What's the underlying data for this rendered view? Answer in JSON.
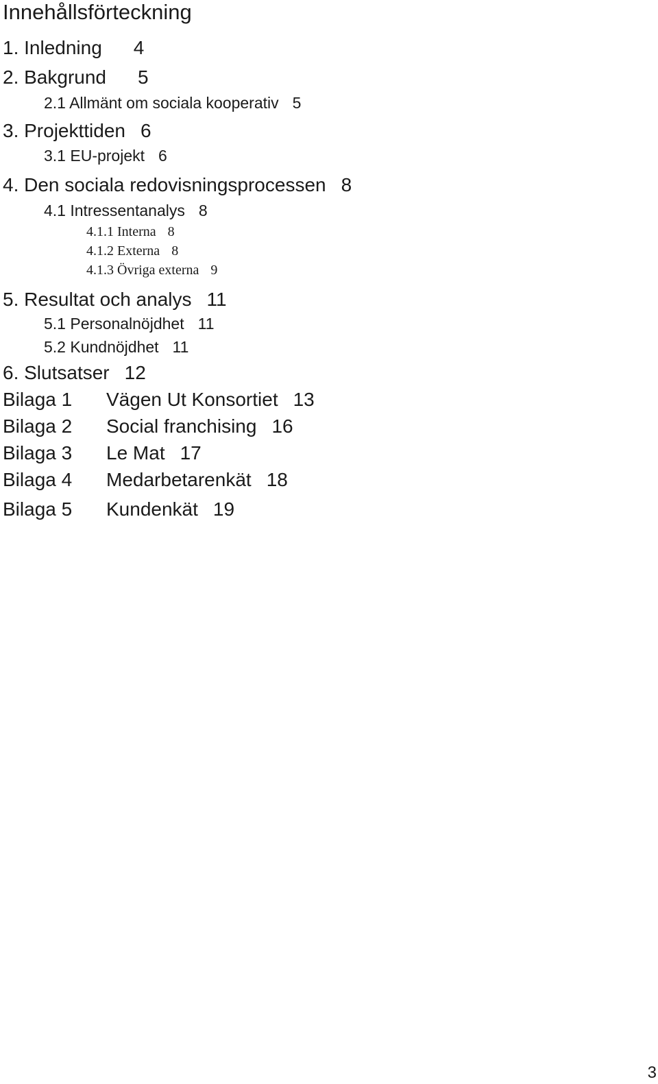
{
  "document": {
    "title": "Innehållsförteckning",
    "page_number": "3",
    "toc": [
      {
        "level": 1,
        "label": "1. Inledning",
        "page": "4"
      },
      {
        "level": 1,
        "label": "2. Bakgrund",
        "page": "5"
      },
      {
        "level": 2,
        "label": "2.1 Allmänt om sociala kooperativ",
        "page": "5"
      },
      {
        "level": 1,
        "label": "3. Projekttiden",
        "page": "6"
      },
      {
        "level": 2,
        "label": "3.1 EU-projekt",
        "page": "6"
      },
      {
        "level": 1,
        "label": "4. Den sociala redovisningsprocessen",
        "page": "8"
      },
      {
        "level": 2,
        "label": "4.1 Intressentanalys",
        "page": "8"
      },
      {
        "level": 3,
        "label": "4.1.1 Interna",
        "page": "8"
      },
      {
        "level": 3,
        "label": "4.1.2 Externa",
        "page": "8"
      },
      {
        "level": 3,
        "label": "4.1.3 Övriga externa",
        "page": "9"
      },
      {
        "level": 1,
        "label": "5. Resultat och analys",
        "page": "11"
      },
      {
        "level": 2,
        "label": "5.1 Personalnöjdhet",
        "page": "11"
      },
      {
        "level": 2,
        "label": "5.2 Kundnöjdhet",
        "page": "11"
      },
      {
        "level": 1,
        "label": "6. Slutsatser",
        "page": "12"
      }
    ],
    "appendices": [
      {
        "label": "Bilaga 1",
        "title": "Vägen Ut Konsortiet",
        "page": "13"
      },
      {
        "label": "Bilaga 2",
        "title": "Social franchising",
        "page": "16"
      },
      {
        "label": "Bilaga 3",
        "title": "Le Mat",
        "page": "17"
      },
      {
        "label": "Bilaga 4",
        "title": "Medarbetarenkät",
        "page": "18"
      },
      {
        "label": "Bilaga 5",
        "title": "Kundenkät",
        "page": "19"
      }
    ]
  }
}
